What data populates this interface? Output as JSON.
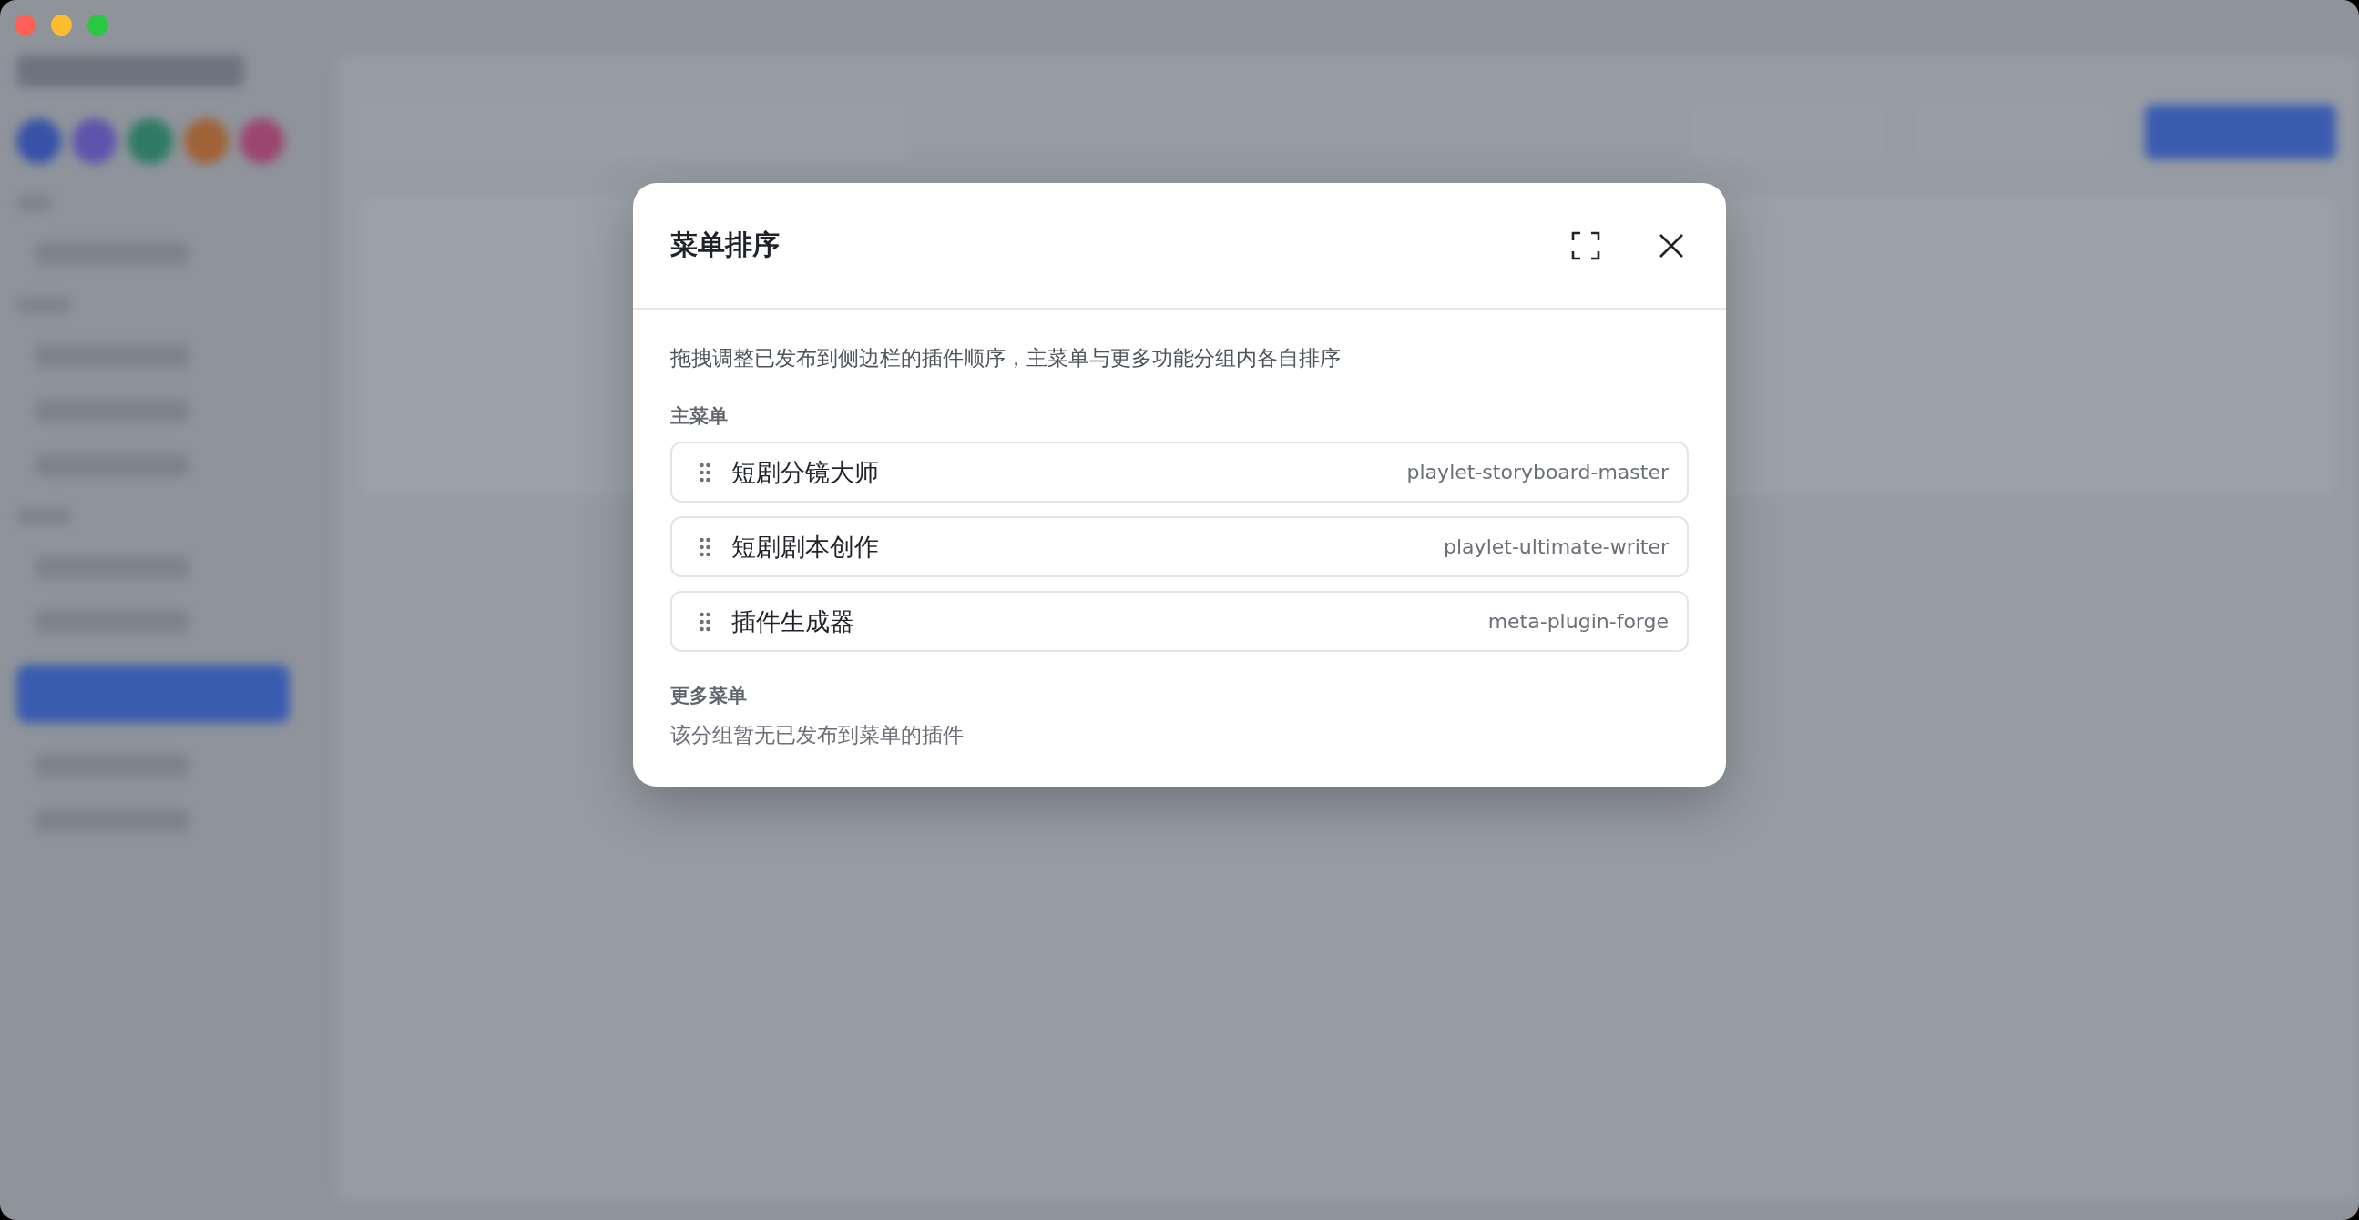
{
  "window": {
    "controls": [
      {
        "kind": "close"
      },
      {
        "kind": "minimize"
      },
      {
        "kind": "zoom"
      }
    ]
  },
  "dialog": {
    "title": "菜单排序",
    "description": "拖拽调整已发布到侧边栏的插件顺序，主菜单与更多功能分组内各自排序",
    "groups": [
      {
        "label": "主菜单",
        "items": [
          {
            "name": "短剧分镜大师",
            "slug": "playlet-storyboard-master"
          },
          {
            "name": "短剧剧本创作",
            "slug": "playlet-ultimate-writer"
          },
          {
            "name": "插件生成器",
            "slug": "meta-plugin-forge"
          }
        ]
      },
      {
        "label": "更多菜单",
        "empty_text": "该分组暂无已发布到菜单的插件"
      }
    ]
  }
}
